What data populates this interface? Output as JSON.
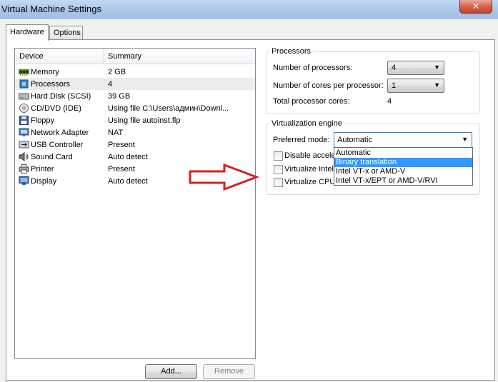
{
  "window": {
    "title": "Virtual Machine Settings",
    "close_glyph": "✕"
  },
  "tabs": [
    {
      "label": "Hardware",
      "active": true
    },
    {
      "label": "Options",
      "active": false
    }
  ],
  "device_list": {
    "columns": [
      "Device",
      "Summary"
    ],
    "rows": [
      {
        "device": "Memory",
        "summary": "2 GB",
        "icon": "memory-icon"
      },
      {
        "device": "Processors",
        "summary": "4",
        "icon": "processor-icon",
        "selected": true
      },
      {
        "device": "Hard Disk (SCSI)",
        "summary": "39 GB",
        "icon": "hard-disk-icon"
      },
      {
        "device": "CD/DVD (IDE)",
        "summary": "Using file C:\\Users\\админ\\Downl...",
        "icon": "cd-dvd-icon"
      },
      {
        "device": "Floppy",
        "summary": "Using file autoinst.flp",
        "icon": "floppy-icon"
      },
      {
        "device": "Network Adapter",
        "summary": "NAT",
        "icon": "network-adapter-icon"
      },
      {
        "device": "USB Controller",
        "summary": "Present",
        "icon": "usb-icon"
      },
      {
        "device": "Sound Card",
        "summary": "Auto detect",
        "icon": "sound-card-icon"
      },
      {
        "device": "Printer",
        "summary": "Present",
        "icon": "printer-icon"
      },
      {
        "device": "Display",
        "summary": "Auto detect",
        "icon": "display-icon"
      }
    ]
  },
  "buttons": {
    "add": "Add...",
    "remove": "Remove"
  },
  "processors": {
    "title": "Processors",
    "num_processors_label": "Number of processors:",
    "num_processors_value": "4",
    "cores_label": "Number of cores per processor:",
    "cores_value": "1",
    "total_label": "Total processor cores:",
    "total_value": "4"
  },
  "virtualization": {
    "title": "Virtualization engine",
    "mode_label": "Preferred mode:",
    "mode_value": "Automatic",
    "options": [
      "Automatic",
      "Binary translation",
      "Intel VT-x or AMD-V",
      "Intel VT-x/EPT or AMD-V/RVI"
    ],
    "highlighted_option": "Binary translation",
    "checkboxes": [
      "Disable acceler",
      "Virtualize Intel",
      "Virtualize CPU"
    ]
  },
  "colors": {
    "annotation_arrow": "#d42020",
    "highlight": "#3399ff"
  }
}
